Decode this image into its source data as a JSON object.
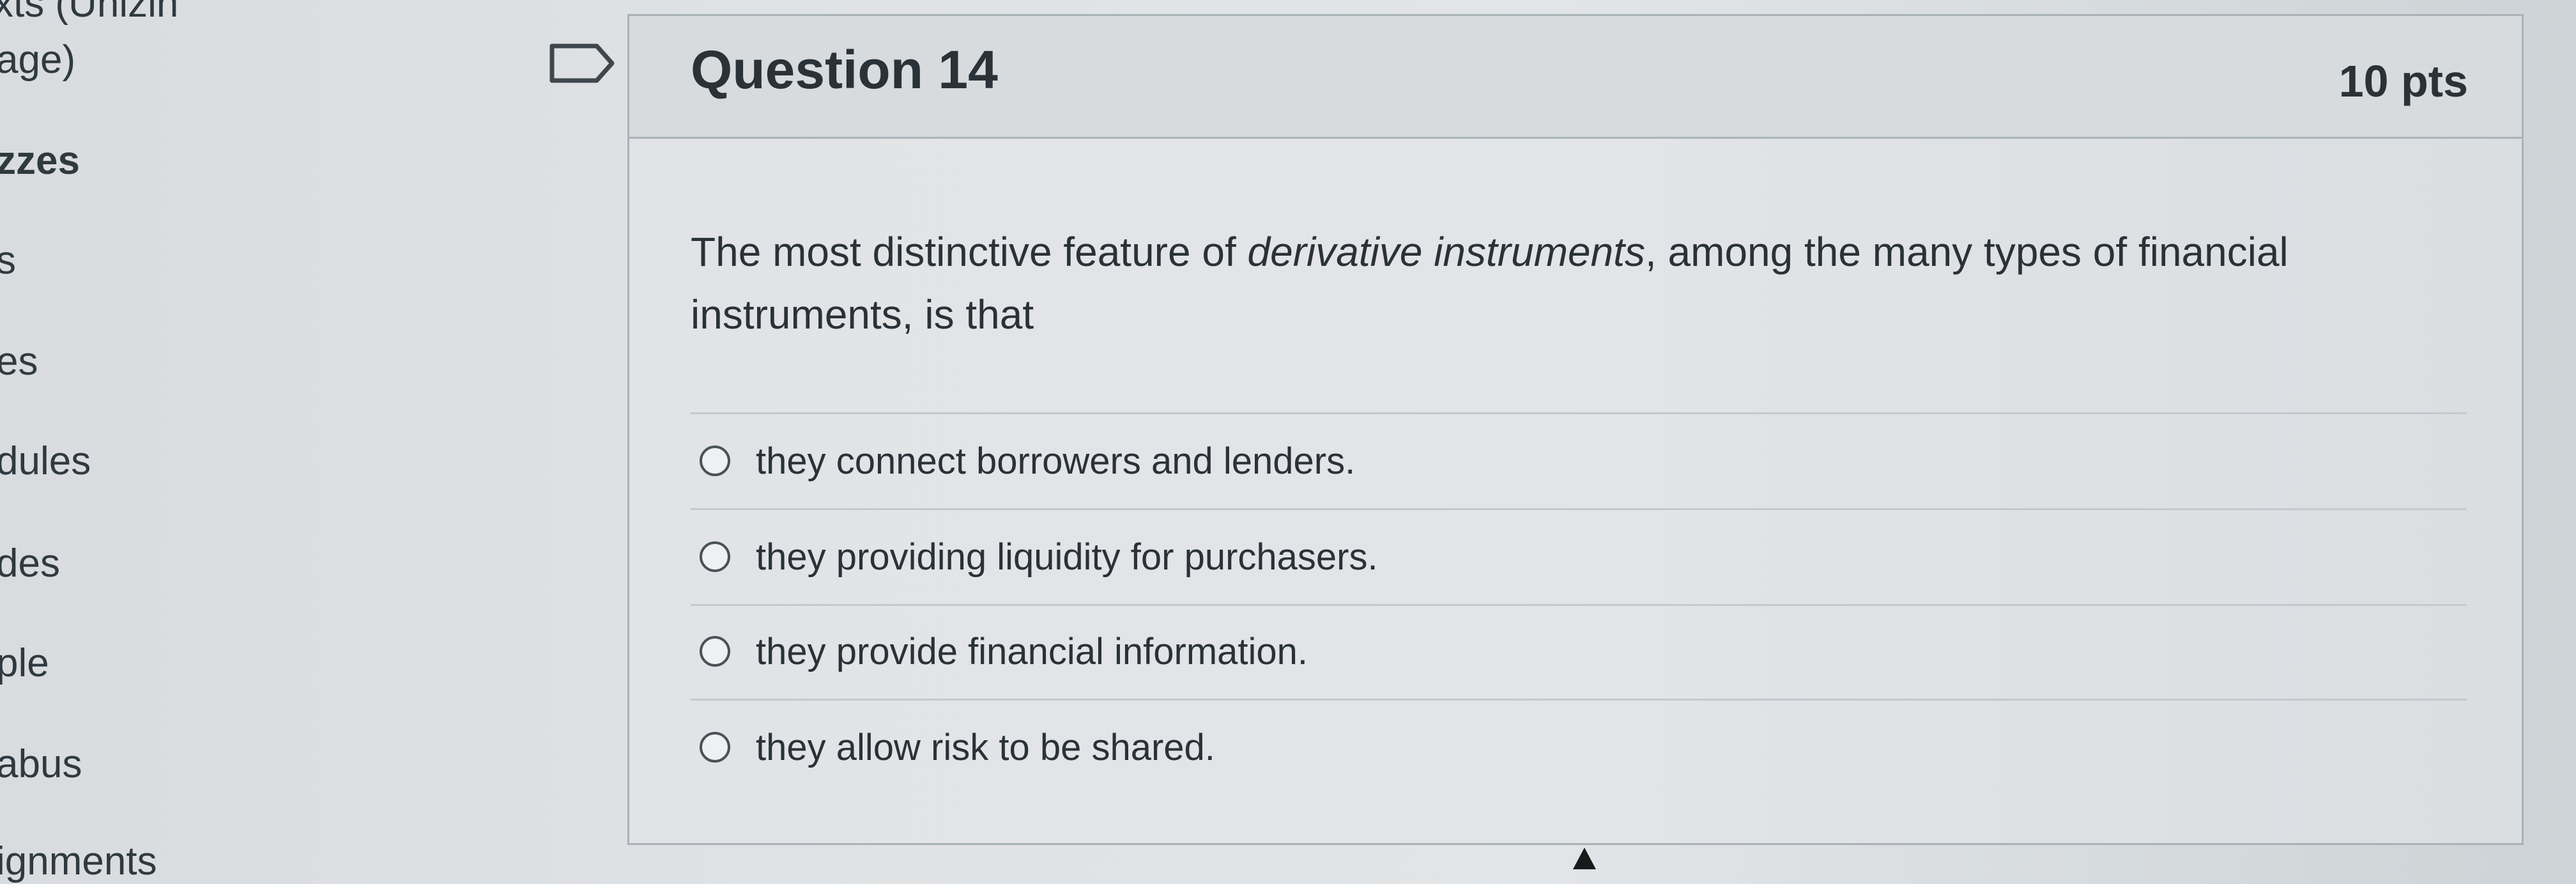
{
  "sidebar": {
    "items": [
      {
        "label": "eTexts (Unizin"
      },
      {
        "label": "age)"
      },
      {
        "label": "zzes"
      },
      {
        "label": "s"
      },
      {
        "label": "es"
      },
      {
        "label": "dules"
      },
      {
        "label": "des"
      },
      {
        "label": "ple"
      },
      {
        "label": "abus"
      },
      {
        "label": "ignments"
      }
    ]
  },
  "question": {
    "title": "Question 14",
    "points": "10 pts",
    "text_before": "The most distinctive feature of ",
    "text_emphasis": "derivative instruments",
    "text_after": ", among the many types of financial instruments, is that",
    "answers": [
      {
        "label": "they connect borrowers and lenders."
      },
      {
        "label": "they providing liquidity for purchasers."
      },
      {
        "label": "they provide financial information."
      },
      {
        "label": "they allow risk to be shared."
      }
    ]
  },
  "icons": {
    "flag": "flag-question-icon",
    "radio": "radio-button-icon"
  }
}
